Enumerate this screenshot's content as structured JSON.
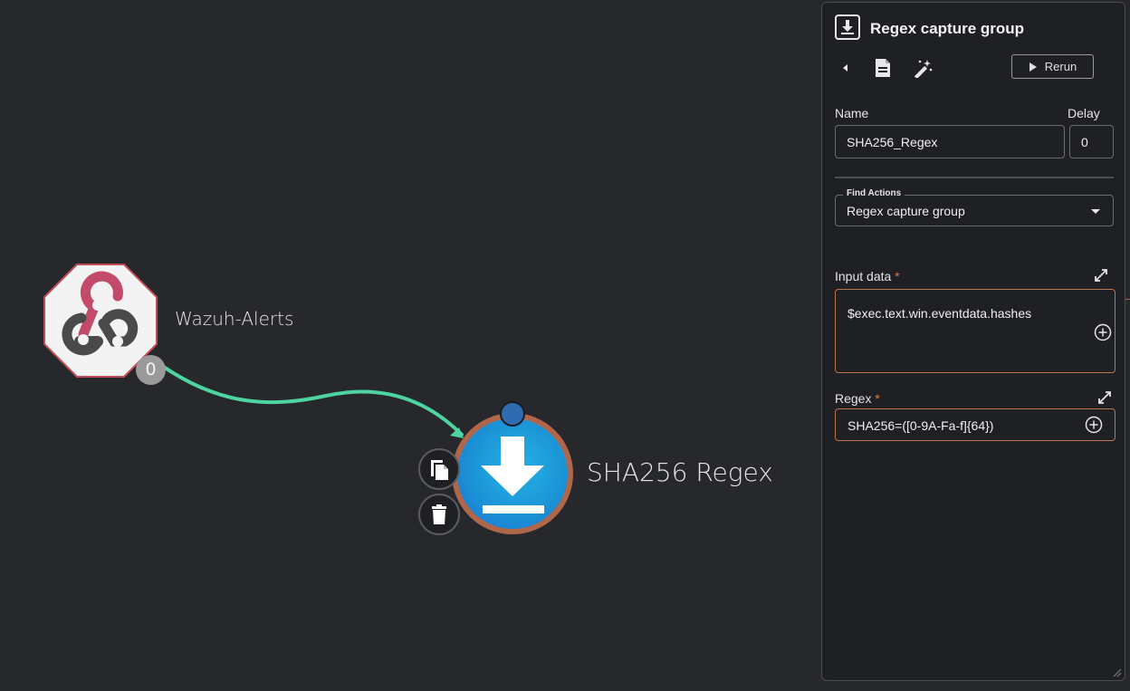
{
  "canvas": {
    "nodes": {
      "webhook": {
        "label": "Wazuh-Alerts",
        "branch_count": "0",
        "icon": "webhook-icon"
      },
      "regex": {
        "label": "SHA256 Regex",
        "icon": "download-icon"
      }
    },
    "node_tools": {
      "copy_icon": "copy-icon",
      "delete_icon": "trash-icon"
    },
    "colors": {
      "edge": "#4dd4a0",
      "regex_ring": "#b06648",
      "regex_fill": "#1c93d6",
      "handle": "#2e6bb0"
    }
  },
  "panel": {
    "title": "Regex capture group",
    "rerun_label": "Rerun",
    "name_label": "Name",
    "name_value": "SHA256_Regex",
    "delay_label": "Delay",
    "delay_value": "0",
    "find_actions_legend": "Find Actions",
    "find_actions_value": "Regex capture group",
    "input_data_label": "Input data",
    "input_data_value": "$exec.text.win.eventdata.hashes",
    "regex_label": "Regex",
    "regex_value": "SHA256=([0-9A-Fa-f]{64})",
    "required_marker": "*",
    "colors": {
      "accent": "#c0744f",
      "required": "#e0773c"
    }
  }
}
